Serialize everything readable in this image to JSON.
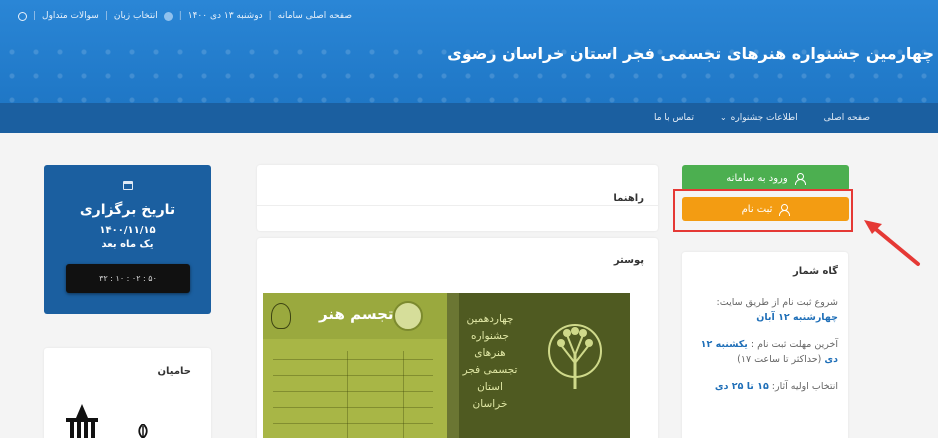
{
  "header": {
    "topbar": {
      "home_link": "صفحه اصلی سامانه",
      "date": "دوشنبه ۱۳ دی ۱۴۰۰",
      "language": "انتخاب زبان",
      "faq": "سوالات متداول"
    },
    "site_title": "چهارمین جشنواره هنرهای تجسمی فجر استان خراسان رضوی"
  },
  "nav": {
    "home": "صفحه اصلی",
    "festival_info": "اطلاعات جشنواره",
    "contact": "تماس با ما"
  },
  "auth": {
    "login_label": "ورود به سامانه",
    "register_label": "ثبت نام"
  },
  "timeline": {
    "title": "گاه شمار",
    "item1_text": "شروع ثبت نام از طریق سایت: ",
    "item1_date": "چهارشنبه ۱۲ آبان",
    "item2_text": "آخرین مهلت ثبت نام : ",
    "item2_date": "یکشنبه ۱۲ دی",
    "item2_note": "(حداکثر تا ساعت ۱۷)",
    "item3_text": "انتخاب اولیه آثار: ",
    "item3_date": "۱۵ تا ۲۵ دی"
  },
  "guide": {
    "title": "راهنما"
  },
  "poster": {
    "title": "پوستر",
    "art_label": "تجسم هنر",
    "festival_text": "چهاردهمین جشنواره هنرهای تجسمی فجر استان خراسان"
  },
  "event": {
    "heading": "تاریخ برگزاری",
    "date": "۱۴۰۰/۱۱/۱۵",
    "relative": "یک ماه بعد",
    "countdown": "۳۲ : ۱۰ : ۰۲ : ۵۰"
  },
  "sponsors": {
    "title": "حامیان"
  },
  "colors": {
    "header_blue": "#2a86d6",
    "nav_blue": "#1b5fa0",
    "login_green": "#4caf50",
    "register_orange": "#f39c12",
    "highlight_red": "#e53935"
  }
}
